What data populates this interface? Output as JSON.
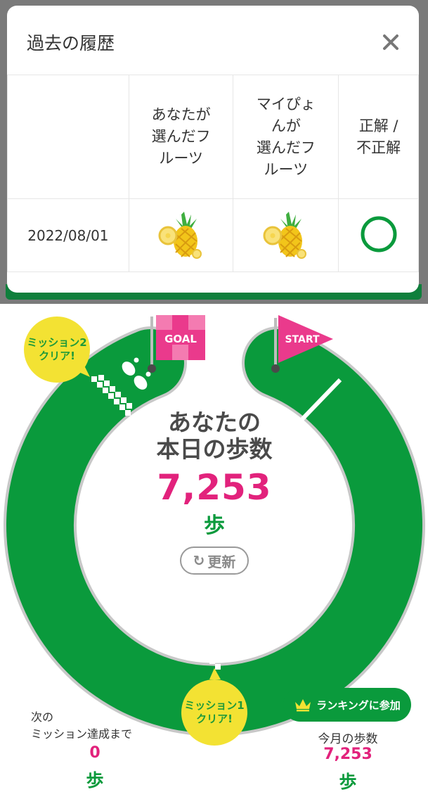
{
  "modal": {
    "title": "過去の履歴",
    "close_icon": "close-icon",
    "columns": [
      "",
      "あなたが\n選んだフ\nルーツ",
      "マイぴょ\nんが\n選んだフ\nルーツ",
      "正解 /\n不正解"
    ],
    "rows": [
      {
        "date": "2022/08/01",
        "your_fruit": "pineapple",
        "mypyon_fruit": "pineapple",
        "result": "correct-circle"
      }
    ]
  },
  "course": {
    "goal_flag": "GOAL",
    "start_flag": "START",
    "mission2_bubble": "ミッション2\nクリア!",
    "mission1_bubble": "ミッション1\nクリア!"
  },
  "center": {
    "title": "あなたの\n本日の歩数",
    "steps": "7,253",
    "unit": "歩",
    "refresh_label": "更新",
    "refresh_icon": "refresh-icon"
  },
  "next_mission": {
    "label": "次の\nミッション達成まで",
    "value": "0",
    "unit": "歩"
  },
  "ranking": {
    "button_label": "ランキングに参加",
    "crown_icon": "crown-icon",
    "month_label": "今月の歩数",
    "month_value": "7,253",
    "month_unit": "歩"
  },
  "colors": {
    "green": "#0a9a3c",
    "pink": "#e2227c",
    "yellow": "#f3e233",
    "flag_pink": "#ea3a8c"
  }
}
